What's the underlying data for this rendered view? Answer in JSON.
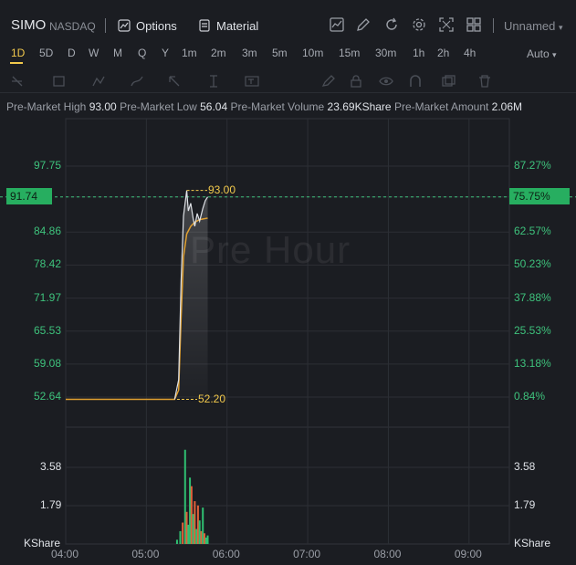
{
  "header": {
    "symbol": "SIMO",
    "exchange": "NASDAQ",
    "options_label": "Options",
    "material_label": "Material",
    "layout_name": "Unnamed",
    "icons": [
      "indicator-icon",
      "draw-icon",
      "refresh-icon",
      "settings-icon",
      "fullscreen-icon",
      "layout-grid-icon"
    ]
  },
  "timeframes": [
    "1D",
    "5D",
    "D",
    "W",
    "M",
    "Q",
    "Y",
    "1m",
    "2m",
    "3m",
    "5m",
    "10m",
    "15m",
    "30m",
    "1h",
    "2h",
    "4h"
  ],
  "active_timeframe": "1D",
  "scale_mode": "Auto",
  "stats": {
    "high_label": "Pre-Market High",
    "high_value": "93.00",
    "low_label": "Pre-Market Low",
    "low_value": "56.04",
    "volume_label": "Pre-Market Volume",
    "volume_value": "23.69KShare",
    "amount_label": "Pre-Market Amount",
    "amount_value": "2.06M"
  },
  "watermark": "Pre Hour",
  "current_price": "91.74",
  "current_pct": "75.75%",
  "high_annotation": "93.00",
  "low_annotation": "52.20",
  "colors": {
    "up": "#3ec27c",
    "accent": "#f2c94c",
    "price_line": "#e0a030",
    "bg": "#1b1d22"
  },
  "chart_data": {
    "type": "line",
    "price_axis_left": [
      "97.75",
      "91.74",
      "84.86",
      "78.42",
      "71.97",
      "65.53",
      "59.08",
      "52.64"
    ],
    "price_axis_right": [
      "87.27%",
      "75.75%",
      "62.57%",
      "50.23%",
      "37.88%",
      "25.53%",
      "13.18%",
      "0.84%"
    ],
    "volume_axis": [
      "3.58",
      "1.79"
    ],
    "volume_unit": "KShare",
    "x_ticks": [
      "04:00",
      "05:00",
      "06:00",
      "07:00",
      "08:00",
      "09:00"
    ],
    "price_series": {
      "x_hours": [
        4.0,
        5.0,
        5.35,
        5.4,
        5.43,
        5.46,
        5.5,
        5.52,
        5.55,
        5.58,
        5.6,
        5.63,
        5.66,
        5.7,
        5.73,
        5.76
      ],
      "values": [
        52.2,
        52.2,
        52.2,
        56.0,
        75.0,
        88.0,
        93.0,
        89.0,
        90.5,
        87.5,
        86.0,
        88.5,
        87.0,
        89.5,
        91.0,
        91.74
      ]
    },
    "average_series": {
      "x_hours": [
        4.0,
        5.0,
        5.35,
        5.4,
        5.43,
        5.46,
        5.5,
        5.55,
        5.6,
        5.66,
        5.76
      ],
      "values": [
        52.2,
        52.2,
        52.2,
        54.0,
        68.0,
        80.0,
        84.5,
        86.0,
        86.8,
        87.3,
        87.6
      ]
    },
    "volume": {
      "x_hours": [
        5.38,
        5.42,
        5.45,
        5.48,
        5.5,
        5.52,
        5.54,
        5.56,
        5.58,
        5.6,
        5.62,
        5.64,
        5.66,
        5.68,
        5.7,
        5.72,
        5.74,
        5.76
      ],
      "values": [
        0.2,
        0.6,
        1.0,
        4.4,
        1.5,
        0.9,
        3.1,
        2.7,
        1.4,
        2.0,
        0.7,
        1.8,
        1.1,
        0.6,
        1.7,
        0.5,
        0.3,
        0.4
      ],
      "up": [
        true,
        true,
        false,
        true,
        false,
        true,
        true,
        false,
        true,
        false,
        true,
        false,
        true,
        false,
        true,
        false,
        true,
        true
      ]
    }
  }
}
